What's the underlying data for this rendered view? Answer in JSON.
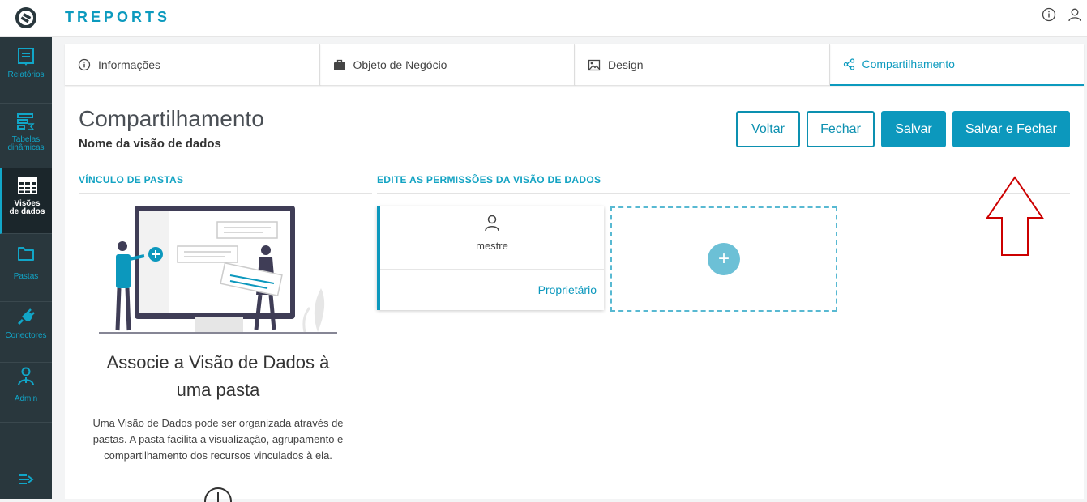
{
  "app": {
    "title": "TREPORTS"
  },
  "sidebar": {
    "items": [
      {
        "label": "Relatórios",
        "icon": "report-icon"
      },
      {
        "label": "Tabelas dinâmicas",
        "icon": "pivot-table-icon"
      },
      {
        "label": "Visões de dados",
        "icon": "data-grid-icon",
        "active": true
      },
      {
        "label": "Pastas",
        "icon": "folder-icon"
      },
      {
        "label": "Conectores",
        "icon": "plug-icon"
      },
      {
        "label": "Admin",
        "icon": "admin-icon"
      }
    ]
  },
  "tabs": [
    {
      "label": "Informações",
      "icon": "info-icon"
    },
    {
      "label": "Objeto de Negócio",
      "icon": "briefcase-icon"
    },
    {
      "label": "Design",
      "icon": "image-icon"
    },
    {
      "label": "Compartilhamento",
      "icon": "share-icon",
      "active": true
    }
  ],
  "page": {
    "title": "Compartilhamento",
    "subtitle": "Nome da visão de dados"
  },
  "buttons": {
    "back": "Voltar",
    "close": "Fechar",
    "save": "Salvar",
    "save_close": "Salvar e Fechar"
  },
  "folders": {
    "section_title": "VÍNCULO DE PASTAS",
    "heading_line1": "Associe a Visão de Dados à",
    "heading_line2": "uma pasta",
    "desc_line1": "Uma Visão de Dados pode ser organizada através de",
    "desc_line2": "pastas. A pasta facilita a visualização, agrupamento e",
    "desc_line3": "compartilhamento dos recursos vinculados à ela."
  },
  "permissions": {
    "section_title": "EDITE AS PERMISSÕES DA VISÃO DE DADOS",
    "owner": {
      "name": "mestre",
      "role": "Proprietário"
    },
    "add_symbol": "+"
  },
  "colors": {
    "accent": "#0c98bd",
    "sidebar": "#29373d",
    "annotation": "#cc0000"
  }
}
